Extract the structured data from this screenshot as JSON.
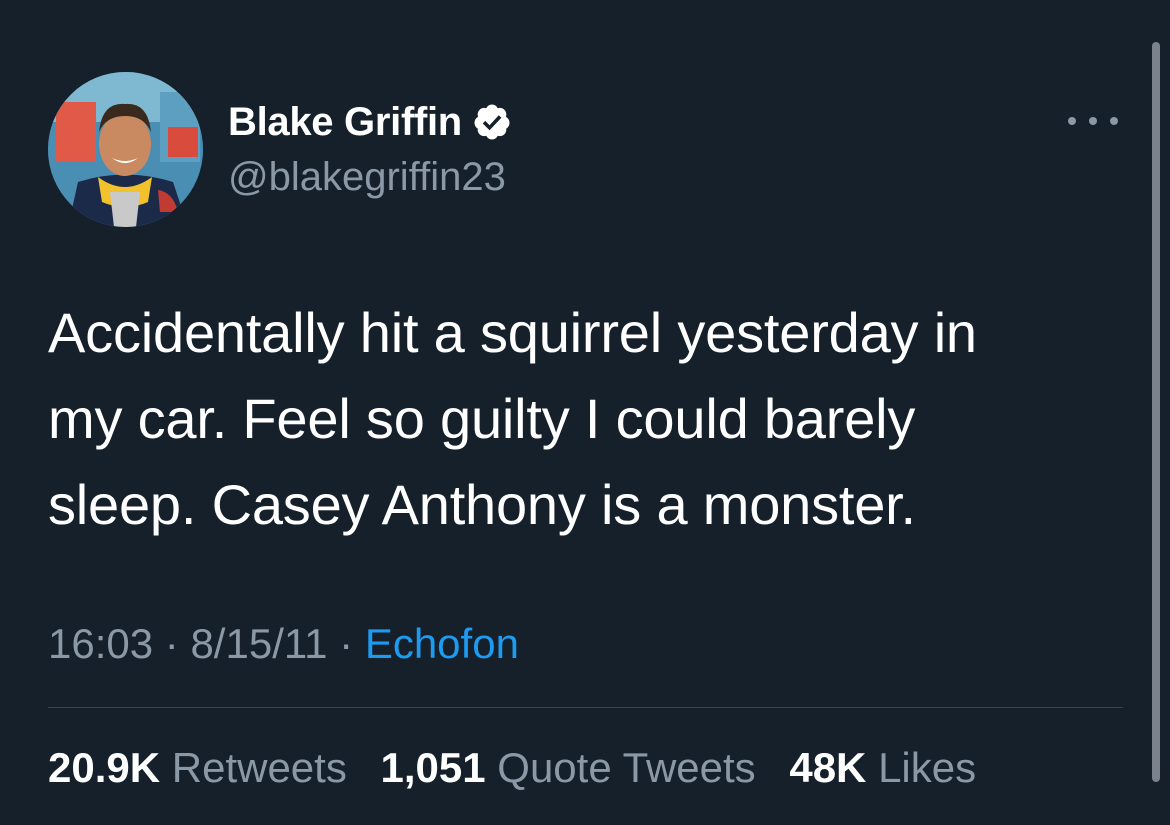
{
  "author": {
    "display_name": "Blake Griffin",
    "handle": "@blakegriffin23",
    "verified": true,
    "avatar_icon": "profile-photo",
    "verified_icon": "verified-badge-icon",
    "more_icon": "more-options-icon"
  },
  "tweet": {
    "text_lines": [
      "Accidentally hit a squirrel yesterday in",
      "my car. Feel so guilty I could barely",
      "sleep. Casey Anthony is a monster."
    ],
    "time": "16:03",
    "separator": "·",
    "date": "8/15/11",
    "source": "Echofon"
  },
  "stats": {
    "retweets_count": "20.9K",
    "retweets_label": "Retweets",
    "quotes_count": "1,051",
    "quotes_label": "Quote Tweets",
    "likes_count": "48K",
    "likes_label": "Likes"
  },
  "colors": {
    "background": "#15202b",
    "text_primary": "#ffffff",
    "text_secondary": "#8b98a5",
    "link": "#1d9bf0",
    "divider": "#38444d"
  }
}
